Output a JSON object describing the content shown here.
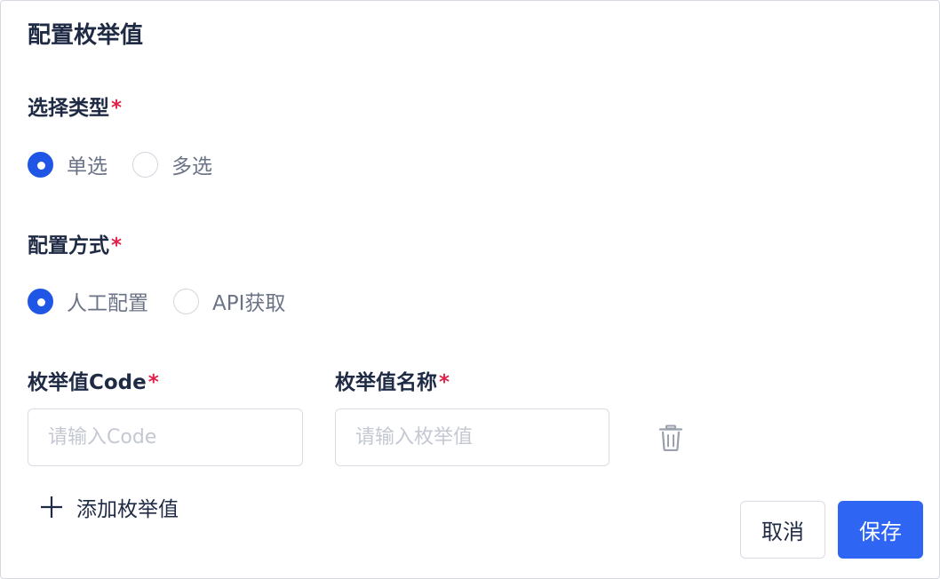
{
  "dialog": {
    "title": "配置枚举值"
  },
  "select_type": {
    "label": "选择类型",
    "required_mark": "*",
    "options": [
      {
        "label": "单选",
        "checked": true
      },
      {
        "label": "多选",
        "checked": false
      }
    ]
  },
  "config_method": {
    "label": "配置方式",
    "required_mark": "*",
    "options": [
      {
        "label": "人工配置",
        "checked": true
      },
      {
        "label": "API获取",
        "checked": false
      }
    ]
  },
  "enum_fields": {
    "code_label": "枚举值Code",
    "name_label": "枚举值名称",
    "required_mark": "*",
    "code_value": "",
    "code_placeholder": "请输入Code",
    "name_value": "",
    "name_placeholder": "请输入枚举值",
    "delete_icon": "trash-icon"
  },
  "add_enum": {
    "label": "添加枚举值",
    "icon": "plus-icon"
  },
  "footer": {
    "cancel_label": "取消",
    "save_label": "保存"
  },
  "colors": {
    "primary": "#2e65f2",
    "radio_checked": "#1f56e6",
    "required": "#e0224a",
    "text": "#1f2a44",
    "muted": "#6b7386",
    "placeholder": "#c4c8d2",
    "border": "#d9dce3"
  }
}
